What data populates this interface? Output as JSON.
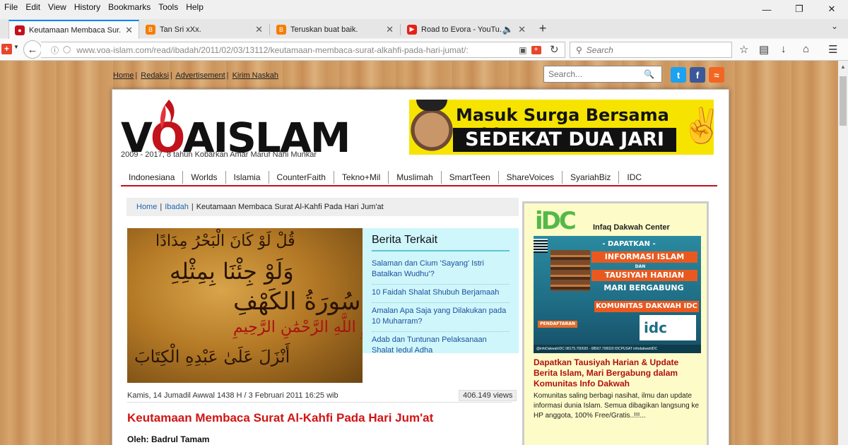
{
  "browser": {
    "menu": [
      "File",
      "Edit",
      "View",
      "History",
      "Bookmarks",
      "Tools",
      "Help"
    ],
    "tabs": [
      {
        "title": "Keutamaan Membaca Sur...",
        "icon_color": "#c2121b"
      },
      {
        "title": "Tan Sri xXx.",
        "icon_color": "#f57d00"
      },
      {
        "title": "Teruskan buat baik.",
        "icon_color": "#f57d00"
      },
      {
        "title": "Road to Evora - YouTu...",
        "icon_color": "#e62117"
      }
    ],
    "url": "www.voa-islam.com/read/ibadah/2011/02/03/13112/keutamaan-membaca-surat-alkahfi-pada-hari-jumat/:",
    "search_placeholder": "Search"
  },
  "site": {
    "toplinks": [
      "Home",
      "Redaksi",
      "Advertisement",
      "Kirim Naskah"
    ],
    "search_placeholder": "Search...",
    "logo": {
      "part1": "V",
      "part2": "O",
      "part3": "AISLAM"
    },
    "tagline": "2009 - 2017, 8 tahun Kobarkan Amar Maruf Nahi Munkar",
    "banner": {
      "line1": "Masuk Surga Bersama Nabi",
      "line2": "SEDEKAT DUA JARI"
    },
    "nav": [
      "Indonesiana",
      "Worlds",
      "Islamia",
      "CounterFaith",
      "Tekno+Mil",
      "Muslimah",
      "SmartTeen",
      "ShareVoices",
      "SyariahBiz",
      "IDC"
    ],
    "breadcrumb": {
      "home": "Home",
      "section": "Ibadah",
      "current": "Keutamaan Membaca Surat Al-Kahfi Pada Hari Jum'at"
    }
  },
  "article": {
    "related_heading": "Berita Terkait",
    "related": [
      "Salaman dan Cium 'Sayang' Istri Batalkan Wudhu'?",
      "10 Faidah Shalat Shubuh Berjamaah",
      "Amalan Apa Saja yang Dilakukan pada 10 Muharram?",
      "Adab dan Tuntunan Pelaksanaan Shalat Iedul Adha"
    ],
    "date": "Kamis, 14 Jumadil Awwal 1438 H / 3 Februari 2011 16:25 wib",
    "views": "406.149 views",
    "title": "Keutamaan Membaca Surat Al-Kahfi Pada Hari Jum'at",
    "author": "Oleh: Badrul Tamam"
  },
  "sidebar": {
    "idc_logo": "iDC",
    "idc_name": "Infaq Dakwah Center",
    "promo": {
      "header": "- DAPATKAN -",
      "ribbon1": "INFORMASI ISLAM",
      "dan": "DAN",
      "ribbon2": "TAUSIYAH HARIAN",
      "ribbon3": "MARI BERGABUNG",
      "ribbon4": "KOMUNITAS DAKWAH IDC",
      "pendaftaran": "PENDAFTARAN",
      "idc_box": "idc",
      "footer": "@infoDakwahIDC   08175.700020 - 08567.700020   IDCPUSAT   infodakwahIDC"
    },
    "title": "Dapatkan Tausiyah Harian & Update Berita Islam, Mari Bergabung dalam Komunitas Info Dakwah",
    "text": "Komunitas saling berbagi nasihat, ilmu dan update informasi dunia Islam. Semua dibagikan langsung ke HP anggota, 100% Free/Gratis..!!!..."
  }
}
